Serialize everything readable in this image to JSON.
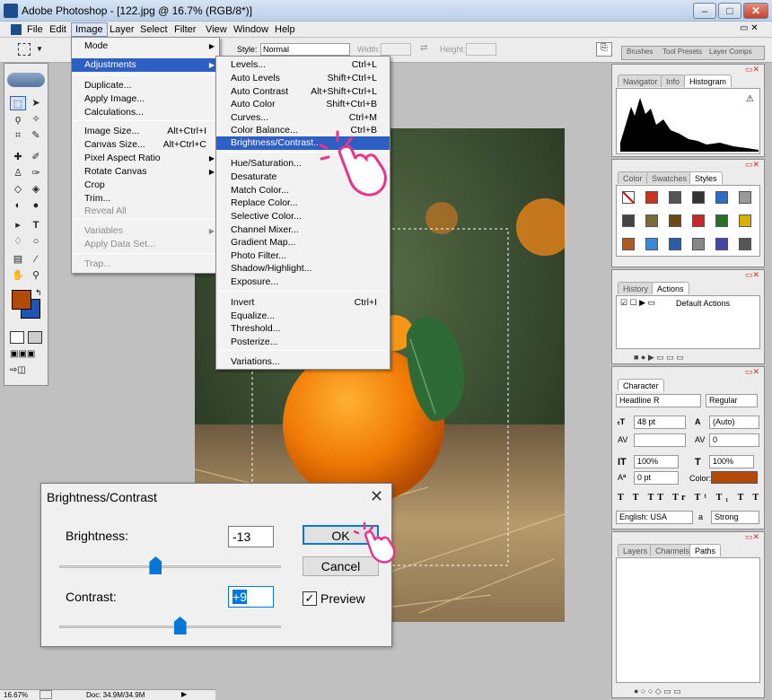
{
  "window": {
    "title": "Adobe Photoshop - [122.jpg @ 16.7% (RGB/8*)]"
  },
  "menubar": {
    "items": [
      "File",
      "Edit",
      "Image",
      "Layer",
      "Select",
      "Filter",
      "View",
      "Window",
      "Help"
    ]
  },
  "options": {
    "style_label": "Style:",
    "style_value": "Normal",
    "width_label": "Width:",
    "height_label": "Height:",
    "tabs": [
      "Brushes",
      "Tool Presets",
      "Layer Comps"
    ]
  },
  "image_menu": {
    "items": [
      {
        "label": "Mode",
        "submenu": true
      },
      {
        "label": "Adjustments",
        "submenu": true,
        "selected": true
      },
      {
        "label": "Duplicate..."
      },
      {
        "label": "Apply Image..."
      },
      {
        "label": "Calculations..."
      },
      {
        "label": "Image Size...",
        "shortcut": "Alt+Ctrl+I"
      },
      {
        "label": "Canvas Size...",
        "shortcut": "Alt+Ctrl+C"
      },
      {
        "label": "Pixel Aspect Ratio",
        "submenu": true
      },
      {
        "label": "Rotate Canvas",
        "submenu": true
      },
      {
        "label": "Crop"
      },
      {
        "label": "Trim..."
      },
      {
        "label": "Reveal All",
        "disabled": true
      },
      {
        "label": "Variables",
        "submenu": true,
        "disabled": true
      },
      {
        "label": "Apply Data Set...",
        "disabled": true
      },
      {
        "label": "Trap...",
        "disabled": true
      }
    ]
  },
  "adjust_menu": {
    "items": [
      {
        "label": "Levels...",
        "shortcut": "Ctrl+L"
      },
      {
        "label": "Auto Levels",
        "shortcut": "Shift+Ctrl+L"
      },
      {
        "label": "Auto Contrast",
        "shortcut": "Alt+Shift+Ctrl+L"
      },
      {
        "label": "Auto Color",
        "shortcut": "Shift+Ctrl+B"
      },
      {
        "label": "Curves...",
        "shortcut": "Ctrl+M"
      },
      {
        "label": "Color Balance...",
        "shortcut": "Ctrl+B"
      },
      {
        "label": "Brightness/Contrast...",
        "selected": true
      },
      {
        "label": "Hue/Saturation..."
      },
      {
        "label": "Desaturate"
      },
      {
        "label": "Match Color..."
      },
      {
        "label": "Replace Color..."
      },
      {
        "label": "Selective Color..."
      },
      {
        "label": "Channel Mixer..."
      },
      {
        "label": "Gradient Map..."
      },
      {
        "label": "Photo Filter..."
      },
      {
        "label": "Shadow/Highlight..."
      },
      {
        "label": "Exposure..."
      },
      {
        "label": "Invert",
        "shortcut": "Ctrl+I"
      },
      {
        "label": "Equalize..."
      },
      {
        "label": "Threshold..."
      },
      {
        "label": "Posterize..."
      },
      {
        "label": "Variations..."
      }
    ]
  },
  "panels": {
    "nav_tabs": [
      "Navigator",
      "Info",
      "Histogram"
    ],
    "color_tabs": [
      "Color",
      "Swatches",
      "Styles"
    ],
    "history_tabs": [
      "History",
      "Actions"
    ],
    "actions_item": "Default Actions",
    "character": {
      "tab": "Character",
      "font": "Headline R",
      "style": "Regular",
      "size": "48 pt",
      "leading": "(Auto)",
      "kerning": "",
      "tracking": "0",
      "vscale": "100%",
      "hscale": "100%",
      "baseline": "0 pt",
      "color_label": "Color:",
      "language": "English: USA",
      "aa_label": "a",
      "aa": "Strong"
    },
    "layers_tabs": [
      "Layers",
      "Channels",
      "Paths"
    ]
  },
  "dialog": {
    "title": "Brightness/Contrast",
    "brightness_label": "Brightness:",
    "brightness_value": "-13",
    "contrast_label": "Contrast:",
    "contrast_value": "+9",
    "ok": "OK",
    "cancel": "Cancel",
    "preview": "Preview"
  },
  "status": {
    "zoom": "16.67%",
    "doc": "Doc: 34.9M/34.9M"
  },
  "colors": {
    "foreground": "#b34a0a",
    "background": "#1d56b8",
    "char_color": "#b34a0a"
  }
}
